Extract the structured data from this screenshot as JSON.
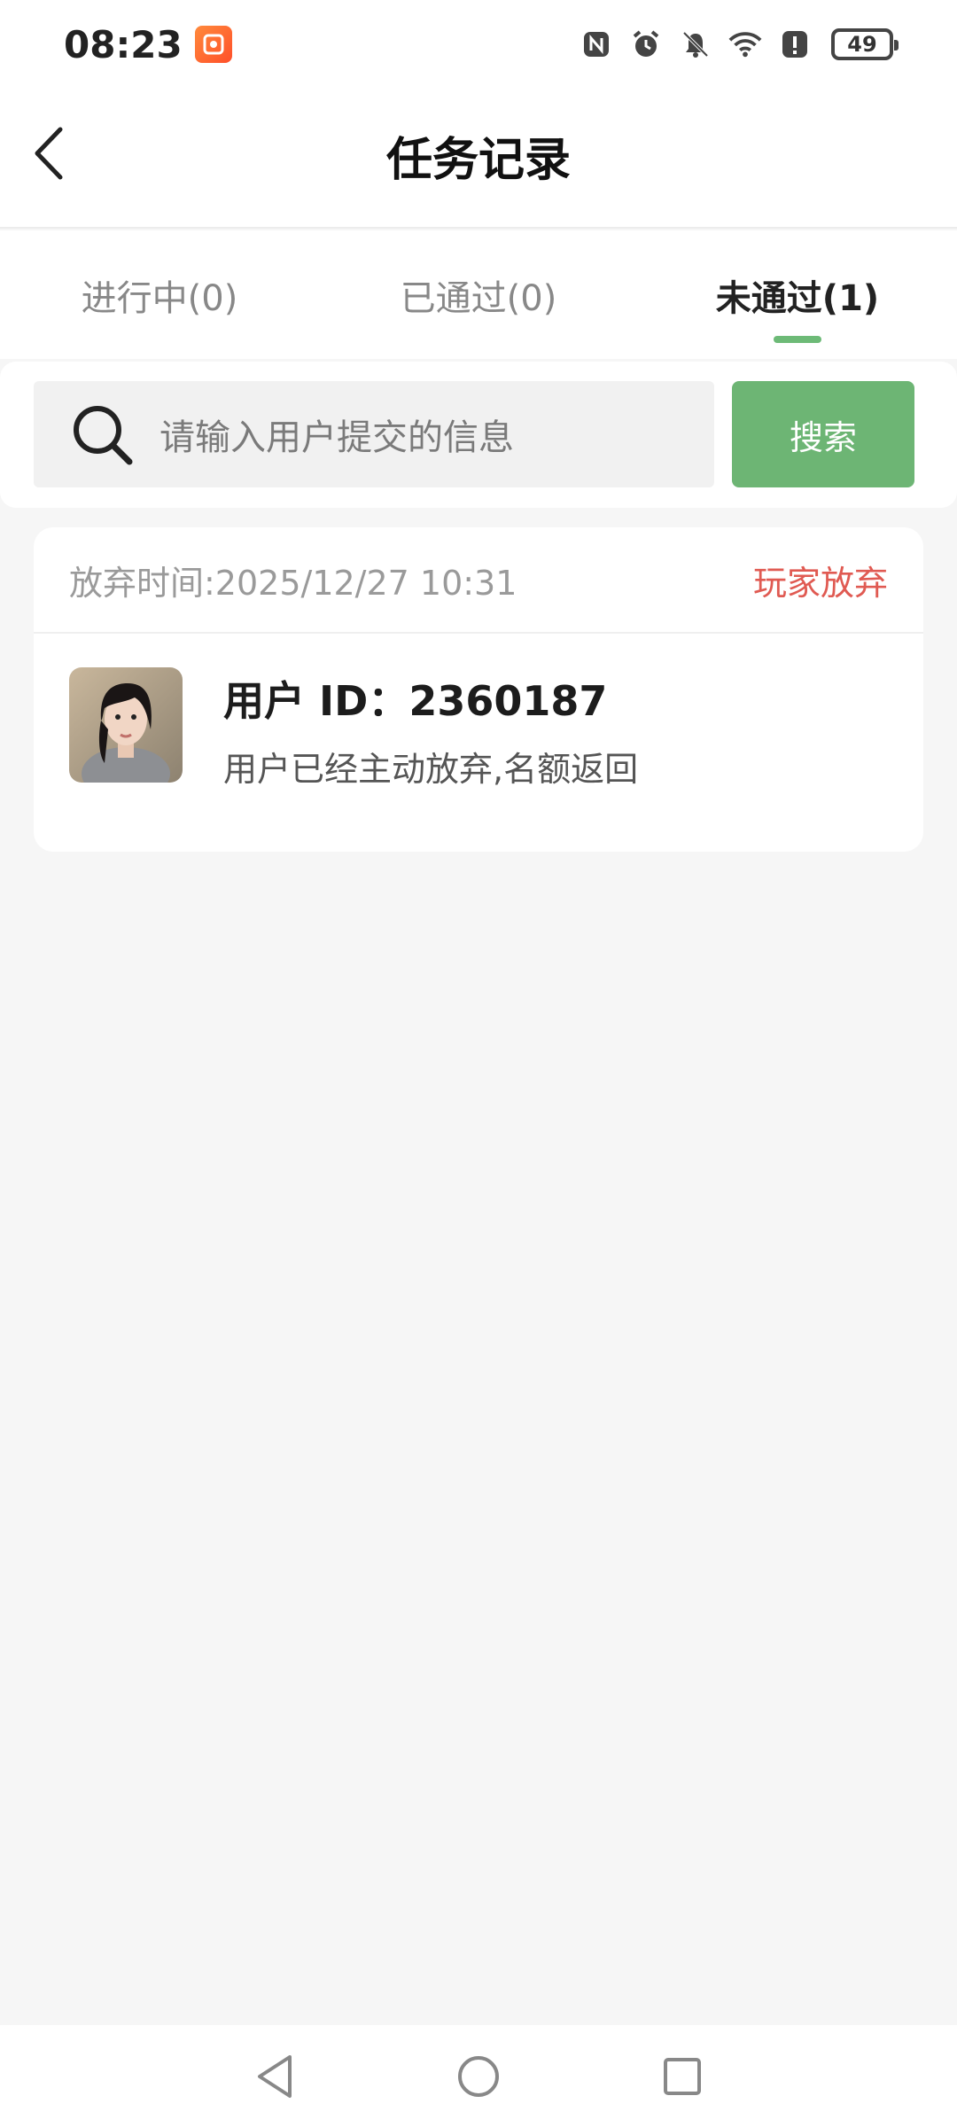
{
  "status_bar": {
    "time": "08:23",
    "battery": "49",
    "icons": [
      "app-notification-icon",
      "nfc-icon",
      "alarm-icon",
      "mute-bell-icon",
      "wifi-icon",
      "alert-icon",
      "battery-icon"
    ]
  },
  "header": {
    "title": "任务记录",
    "back_icon": "back-chevron-icon"
  },
  "tabs": [
    {
      "label": "进行中(0)",
      "active": false
    },
    {
      "label": "已通过(0)",
      "active": false
    },
    {
      "label": "未通过(1)",
      "active": true
    }
  ],
  "search": {
    "placeholder": "请输入用户提交的信息",
    "button_label": "搜索",
    "icon": "search-icon"
  },
  "records": [
    {
      "time_label": "放弃时间:2025/12/27 10:31",
      "status": "玩家放弃",
      "user_id": "用户 ID：2360187",
      "message": "用户已经主动放弃,名额返回"
    }
  ],
  "colors": {
    "accent": "#6db574",
    "status_red": "#e05a52",
    "background": "#f6f6f6"
  },
  "nav": {
    "icons": [
      "nav-back-icon",
      "nav-home-icon",
      "nav-recents-icon"
    ]
  }
}
